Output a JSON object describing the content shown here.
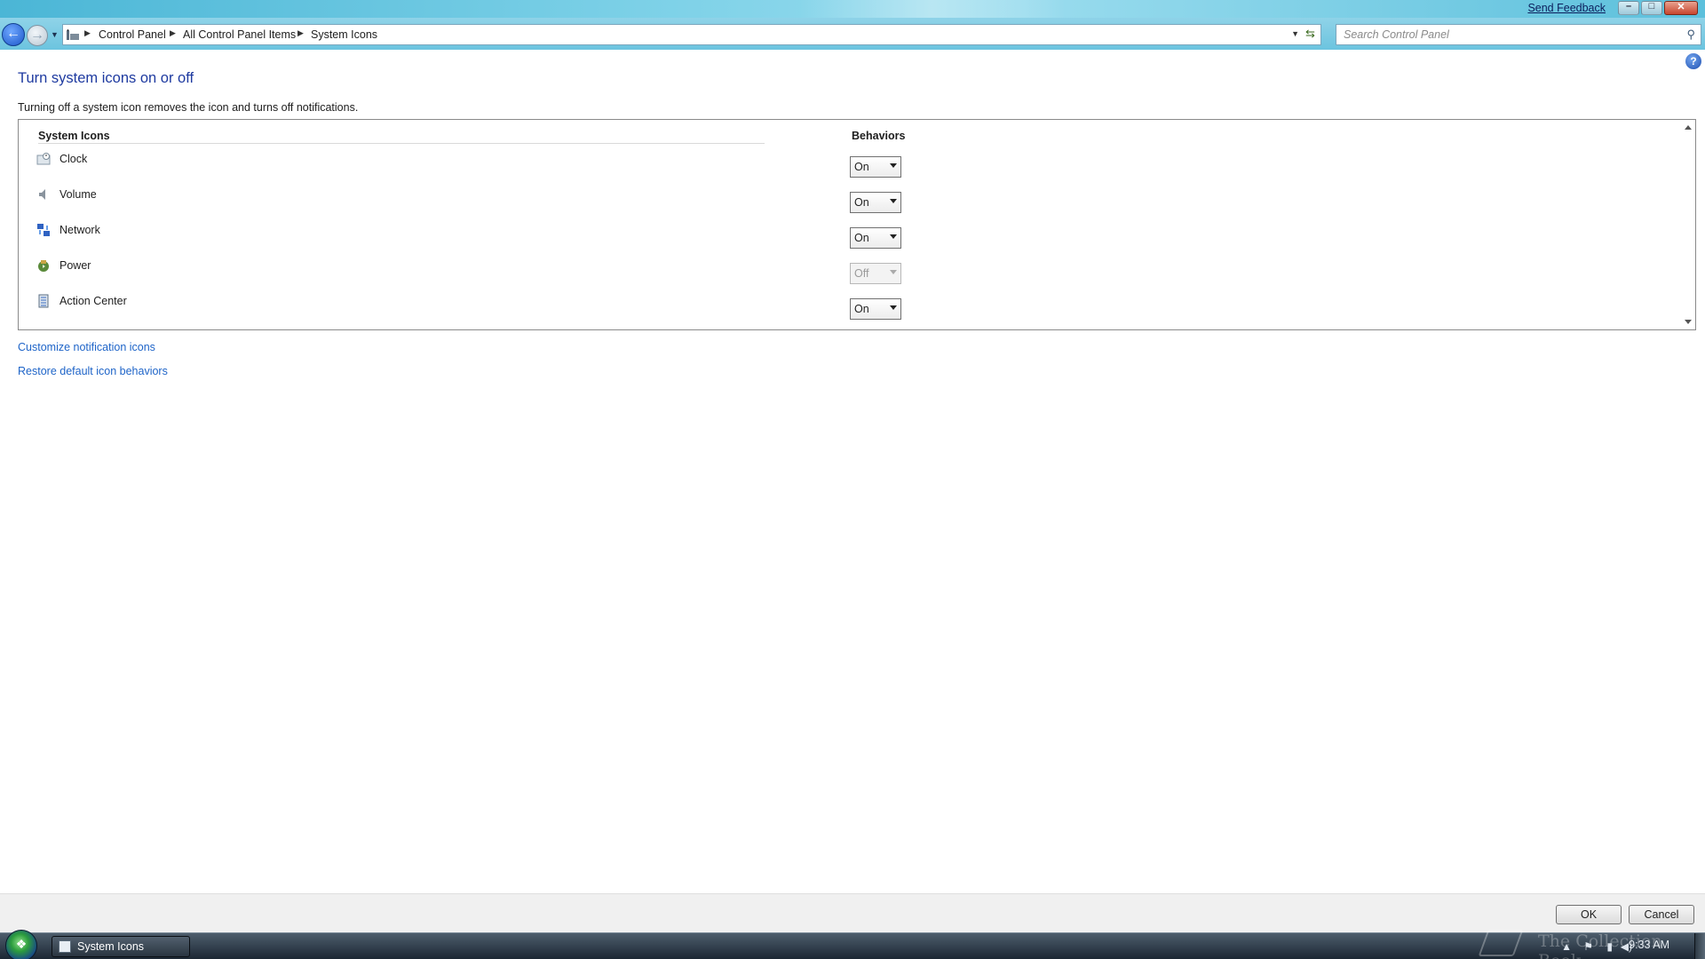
{
  "window": {
    "send_feedback": "Send Feedback",
    "min_label": "–",
    "max_label": "□",
    "close_label": "✕"
  },
  "address_bar": {
    "crumbs": [
      "Control Panel",
      "All Control Panel Items",
      "System Icons"
    ],
    "search_placeholder": "Search Control Panel"
  },
  "page": {
    "title": "Turn system icons on or off",
    "description": "Turning off a system icon removes the icon and turns off notifications.",
    "col_icons": "System Icons",
    "col_behaviors": "Behaviors",
    "rows": [
      {
        "label": "Clock",
        "value": "On",
        "disabled": false,
        "icon": "clock-icon"
      },
      {
        "label": "Volume",
        "value": "On",
        "disabled": false,
        "icon": "volume-icon"
      },
      {
        "label": "Network",
        "value": "On",
        "disabled": false,
        "icon": "network-icon"
      },
      {
        "label": "Power",
        "value": "Off",
        "disabled": true,
        "icon": "power-icon"
      },
      {
        "label": "Action Center",
        "value": "On",
        "disabled": false,
        "icon": "action-center-icon"
      }
    ],
    "links": {
      "customize": "Customize notification icons",
      "restore": "Restore default icon behaviors"
    }
  },
  "buttons": {
    "ok": "OK",
    "cancel": "Cancel"
  },
  "taskbar": {
    "task_label": "System Icons",
    "clock": "9:33 AM",
    "watermark": "The Collection Book"
  },
  "colors": {
    "link": "#1e64c8",
    "title": "#1e3aa0"
  }
}
